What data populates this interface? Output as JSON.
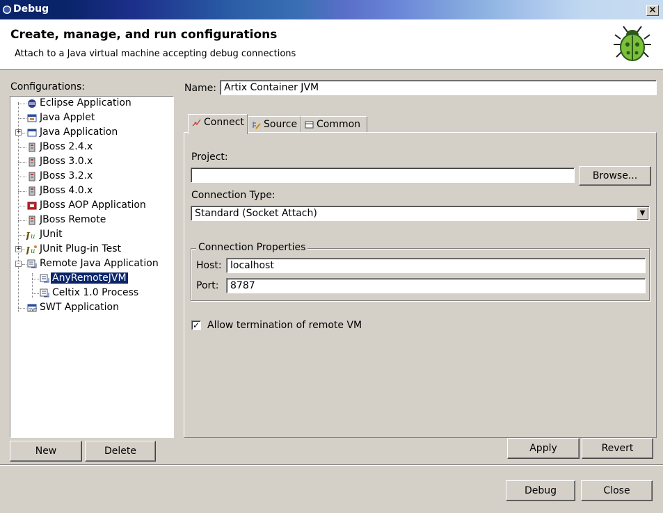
{
  "window": {
    "title": "Debug",
    "close_label": "×"
  },
  "header": {
    "title": "Create, manage, and run configurations",
    "subtitle": "Attach to a Java virtual machine accepting debug connections",
    "bug_icon": "bug-icon"
  },
  "sidebar": {
    "label": "Configurations:",
    "items": [
      {
        "label": "Eclipse Application",
        "icon": "eclipse-icon",
        "level": 0
      },
      {
        "label": "Java Applet",
        "icon": "applet-icon",
        "level": 0
      },
      {
        "label": "Java Application",
        "icon": "java-app-icon",
        "level": 0,
        "expander": "+"
      },
      {
        "label": "JBoss 2.4.x",
        "icon": "jboss-icon",
        "level": 0
      },
      {
        "label": "JBoss 3.0.x",
        "icon": "jboss-icon",
        "level": 0
      },
      {
        "label": "JBoss 3.2.x",
        "icon": "jboss-icon",
        "level": 0
      },
      {
        "label": "JBoss 4.0.x",
        "icon": "jboss-icon",
        "level": 0
      },
      {
        "label": "JBoss AOP Application",
        "icon": "jboss-aop-icon",
        "level": 0
      },
      {
        "label": "JBoss Remote",
        "icon": "jboss-icon",
        "level": 0
      },
      {
        "label": "JUnit",
        "icon": "junit-icon",
        "level": 0
      },
      {
        "label": "JUnit Plug-in Test",
        "icon": "junit-plugin-icon",
        "level": 0,
        "expander": "+"
      },
      {
        "label": "Remote Java Application",
        "icon": "remote-java-icon",
        "level": 0,
        "expander": "-"
      },
      {
        "label": "AnyRemoteJVM",
        "icon": "remote-java-icon",
        "level": 1,
        "selected": true
      },
      {
        "label": "Celtix 1.0 Process",
        "icon": "remote-java-icon",
        "level": 1
      },
      {
        "label": "SWT Application",
        "icon": "swt-icon",
        "level": 0
      }
    ],
    "new_label": "New",
    "delete_label": "Delete"
  },
  "main": {
    "name_label": "Name:",
    "name_value": "Artix Container JVM",
    "tabs": [
      {
        "label": "Connect",
        "icon": "connect-icon",
        "active": true
      },
      {
        "label": "Source",
        "icon": "source-icon"
      },
      {
        "label": "Common",
        "icon": "common-icon"
      }
    ],
    "project_label": "Project:",
    "project_value": "",
    "browse_label": "Browse...",
    "connection_type_label": "Connection Type:",
    "connection_type_value": "Standard (Socket Attach)",
    "connection_props_label": "Connection Properties",
    "host_label": "Host:",
    "host_value": "localhost",
    "port_label": "Port:",
    "port_value": "8787",
    "allow_termination_label": "Allow termination of remote VM",
    "allow_termination_checked": true,
    "apply_label": "Apply",
    "revert_label": "Revert"
  },
  "footer": {
    "debug_label": "Debug",
    "close_label": "Close"
  }
}
